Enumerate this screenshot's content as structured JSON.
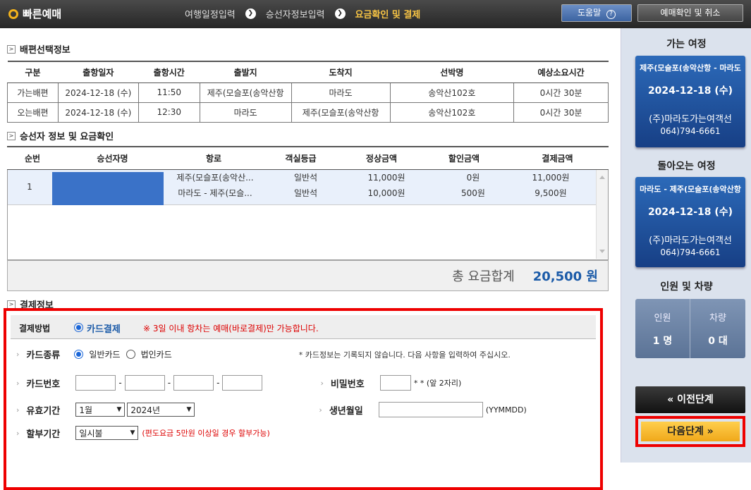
{
  "brand": {
    "title": "빠른예매"
  },
  "steps": {
    "step1": "여행일정입력",
    "step2": "승선자정보입력",
    "step3": "요금확인 및 결제"
  },
  "topbuttons": {
    "help": "도움말",
    "help_icon": "?",
    "cancel": "예매확인 및 취소"
  },
  "ship_section": {
    "title": "배편선택정보",
    "headers": [
      "구분",
      "출항일자",
      "출항시간",
      "출발지",
      "도착지",
      "선박명",
      "예상소요시간"
    ],
    "rows": [
      [
        "가는배편",
        "2024-12-18 (수)",
        "11:50",
        "제주(모슬포(송악산항",
        "마라도",
        "송악산102호",
        "0시간 30분"
      ],
      [
        "오는배편",
        "2024-12-18 (수)",
        "12:30",
        "마라도",
        "제주(모슬포(송악산항",
        "송악산102호",
        "0시간 30분"
      ]
    ]
  },
  "pax_section": {
    "title": "승선자 정보 및 요금확인",
    "headers": [
      "순번",
      "승선자명",
      "항로",
      "객실등급",
      "정상금액",
      "할인금액",
      "결제금액"
    ],
    "row": {
      "no": "1",
      "routes": [
        "제주(모슬포(송악산...",
        "마라도 - 제주(모슬..."
      ],
      "grades": [
        "일반석",
        "일반석"
      ],
      "normal": [
        "11,000원",
        "10,000원"
      ],
      "discount": [
        "0원",
        "500원"
      ],
      "pay": [
        "11,000원",
        "9,500원"
      ]
    },
    "total_label": "총 요금합계",
    "total_amount": "20,500 원"
  },
  "payment": {
    "title": "결제정보",
    "method_label": "결제방법",
    "method_value": "카드결제",
    "notice": "※ 3일 이내 항차는 예매(바로결제)만 가능합니다.",
    "card_type_label": "카드종류",
    "card_personal": "일반카드",
    "card_corp": "법인카드",
    "card_info": "* 카드정보는 기록되지 않습니다. 다음 사항을 입력하여 주십시오.",
    "card_number_label": "카드번호",
    "password_label": "비밀번호",
    "password_hint": "* * (앞 2자리)",
    "expiry_label": "유효기간",
    "expiry_month": "1월",
    "expiry_year": "2024년",
    "birth_label": "생년월일",
    "birth_hint": "(YYMMDD)",
    "installment_label": "할부기간",
    "installment_value": "일시불",
    "installment_note": "(편도요금 5만원 이상일 경우 할부가능)"
  },
  "sidebar": {
    "outbound_title": "가는 여정",
    "outbound": {
      "route": "제주(모슬포(송악산항 - 마라도",
      "date": "2024-12-18 (수)",
      "company": "(주)마라도가는여객선",
      "tel": "064)794-6661"
    },
    "return_title": "돌아오는 여정",
    "return": {
      "route": "마라도 - 제주(모슬포(송악산항",
      "date": "2024-12-18 (수)",
      "company": "(주)마라도가는여객선",
      "tel": "064)794-6661"
    },
    "count_title": "인원 및 차량",
    "people_label": "인원",
    "people_value": "1 명",
    "vehicle_label": "차량",
    "vehicle_value": "0 대",
    "prev": "« 이전단계",
    "next": "다음단계 »"
  },
  "colors": {
    "accent": "#1a5aa8",
    "highlight": "#e00000",
    "step_current": "#f6c344"
  }
}
